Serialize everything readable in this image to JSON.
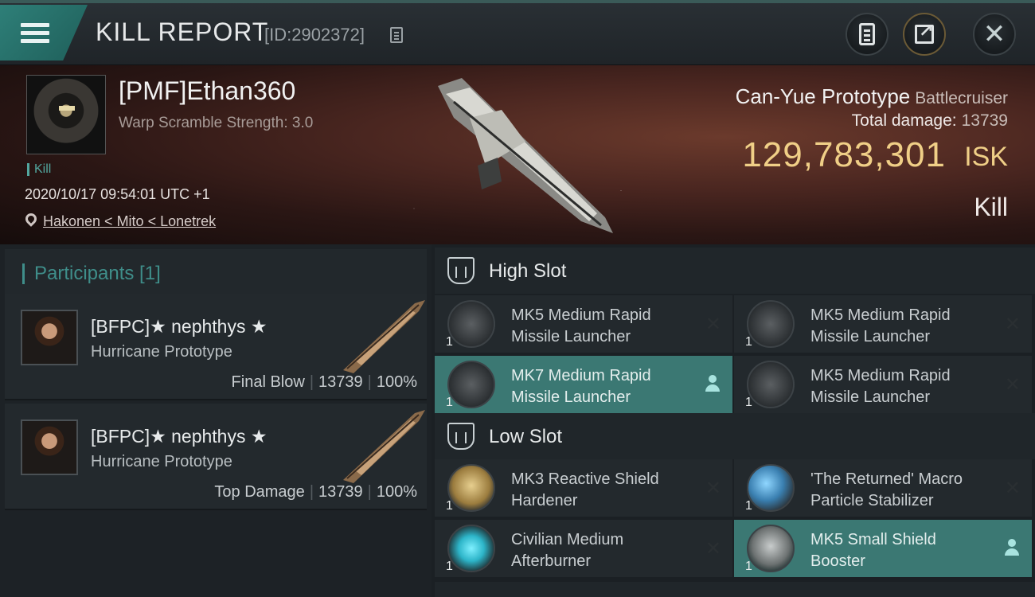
{
  "header": {
    "title": "KILL REPORT",
    "report_id": "[ID:2902372]"
  },
  "victim": {
    "name": "[PMF]Ethan360",
    "warp_scramble": "Warp Scramble Strength: 3.0",
    "tag": "Kill",
    "timestamp": "2020/10/17 09:54:01 UTC +1",
    "location": "Hakonen < Mito < Lonetrek",
    "ship_name": "Can-Yue Prototype",
    "ship_class": "Battlecruiser",
    "total_damage_label": "Total damage:",
    "total_damage": "13739",
    "isk_value": "129,783,301",
    "isk_unit": "ISK",
    "result": "Kill"
  },
  "participants": {
    "title": "Participants [1]",
    "items": [
      {
        "name": "[BFPC]★ nephthys ★",
        "ship": "Hurricane Prototype",
        "role": "Final Blow",
        "damage": "13739",
        "percent": "100%"
      },
      {
        "name": "[BFPC]★ nephthys ★",
        "ship": "Hurricane Prototype",
        "role": "Top Damage",
        "damage": "13739",
        "percent": "100%"
      }
    ]
  },
  "fitting": {
    "high_slot": {
      "title": "High Slot",
      "modules": [
        {
          "name_l1": "MK5 Medium Rapid",
          "name_l2": "Missile Launcher",
          "qty": "1"
        },
        {
          "name_l1": "MK5 Medium Rapid",
          "name_l2": "Missile Launcher",
          "qty": "1"
        },
        {
          "name_l1": "MK7 Medium Rapid",
          "name_l2": "Missile Launcher",
          "qty": "1"
        },
        {
          "name_l1": "MK5 Medium Rapid",
          "name_l2": "Missile Launcher",
          "qty": "1"
        }
      ]
    },
    "low_slot": {
      "title": "Low Slot",
      "modules": [
        {
          "name_l1": "MK3 Reactive Shield",
          "name_l2": "Hardener",
          "qty": "1"
        },
        {
          "name_l1": "'The Returned' Macro",
          "name_l2": "Particle Stabilizer",
          "qty": "1"
        },
        {
          "name_l1": "Civilian Medium",
          "name_l2": "Afterburner",
          "qty": "1"
        },
        {
          "name_l1": "MK5 Small Shield",
          "name_l2": "Booster",
          "qty": "1"
        }
      ]
    }
  },
  "colors": {
    "accent_teal": "#3b7873",
    "isk_gold": "#f0cf87"
  }
}
